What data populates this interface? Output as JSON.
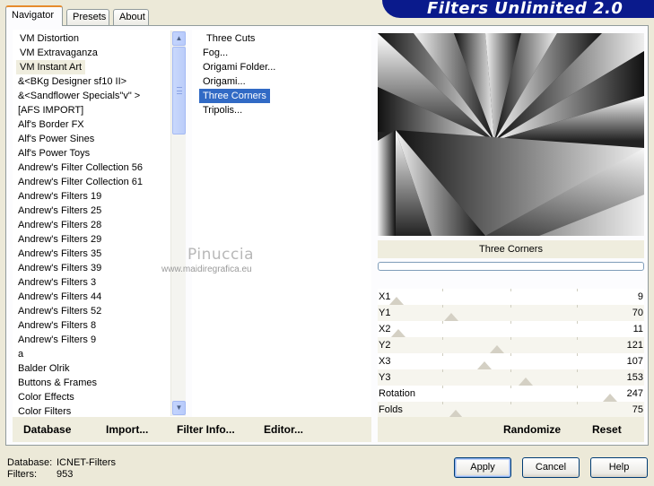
{
  "banner": {
    "title": "Filters Unlimited 2.0",
    "color": "#0a1a8c"
  },
  "tabs": [
    {
      "label": "Navigator",
      "active": true
    },
    {
      "label": "Presets",
      "active": false
    },
    {
      "label": "About",
      "active": false
    }
  ],
  "categories": [
    "VM Distortion",
    "VM Extravaganza",
    "VM Instant Art",
    "&<BKg Designer sf10 II>",
    "&<Sandflower Specials\"v\" >",
    "[AFS IMPORT]",
    "Alf's Border FX",
    "Alf's Power Sines",
    "Alf's Power Toys",
    "Andrew's Filter Collection 56",
    "Andrew's Filter Collection 61",
    "Andrew's Filters 19",
    "Andrew's Filters 25",
    "Andrew's Filters 28",
    "Andrew's Filters 29",
    "Andrew's Filters 35",
    "Andrew's Filters 39",
    "Andrew's Filters 3",
    "Andrew's Filters 44",
    "Andrew's Filters 52",
    "Andrew's Filters 8",
    "Andrew's Filters 9",
    "a",
    "Balder Olrik",
    "Buttons & Frames",
    "Color Effects",
    "Color Filters"
  ],
  "categories_selected": "VM Instant Art",
  "filters": [
    "Three Cuts",
    "Fog...",
    "Origami Folder...",
    "Origami...",
    "Three Corners",
    "Tripolis..."
  ],
  "filters_selected": "Three Corners",
  "watermark": {
    "name": "Pinuccia",
    "url": "www.maidiregrafica.eu"
  },
  "preview": {
    "title": "Three Corners"
  },
  "params": [
    {
      "label": "X1",
      "value": "9",
      "level": 0.035
    },
    {
      "label": "Y1",
      "value": "70",
      "level": 0.275
    },
    {
      "label": "X2",
      "value": "11",
      "level": 0.043
    },
    {
      "label": "Y2",
      "value": "121",
      "level": 0.475
    },
    {
      "label": "X3",
      "value": "107",
      "level": 0.42
    },
    {
      "label": "Y3",
      "value": "153",
      "level": 0.6
    },
    {
      "label": "Rotation",
      "value": "247",
      "level": 0.969
    },
    {
      "label": "Folds",
      "value": "75",
      "level": 0.294
    }
  ],
  "bottom_left": {
    "database": "Database",
    "import": "Import...",
    "filter_info": "Filter Info...",
    "editor": "Editor..."
  },
  "bottom_right": {
    "randomize": "Randomize",
    "reset": "Reset"
  },
  "status": {
    "database_label": "Database:",
    "database_value": "ICNET-Filters",
    "filters_label": "Filters:",
    "filters_value": "953"
  },
  "buttons": {
    "apply": "Apply",
    "cancel": "Cancel",
    "help": "Help"
  }
}
